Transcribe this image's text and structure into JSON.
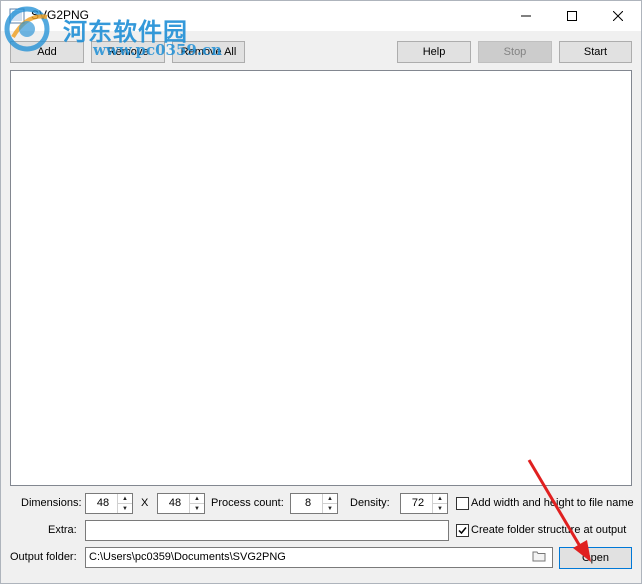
{
  "window": {
    "title": "SVG2PNG"
  },
  "watermark": {
    "text": "河东软件园",
    "url": "www.pc0359.cn"
  },
  "toolbar": {
    "add_label": "Add",
    "remove_label": "Remove",
    "remove_all_label": "Remove All",
    "help_label": "Help",
    "stop_label": "Stop",
    "start_label": "Start"
  },
  "options": {
    "dimensions_label": "Dimensions:",
    "width": "48",
    "x_label": "X",
    "height": "48",
    "process_count_label": "Process count:",
    "process_count": "8",
    "density_label": "Density:",
    "density": "72",
    "add_wh_label": "Add width and height to file name",
    "add_wh_checked": false,
    "extra_label": "Extra:",
    "extra_value": "",
    "create_folder_label": "Create folder structure at output",
    "create_folder_checked": true,
    "output_folder_label": "Output folder:",
    "output_folder_value": "C:\\Users\\pc0359\\Documents\\SVG2PNG",
    "open_label": "Open"
  },
  "colors": {
    "accent": "#0078d7",
    "watermark": "#1f8fd6",
    "annotation_arrow": "#e02020"
  }
}
